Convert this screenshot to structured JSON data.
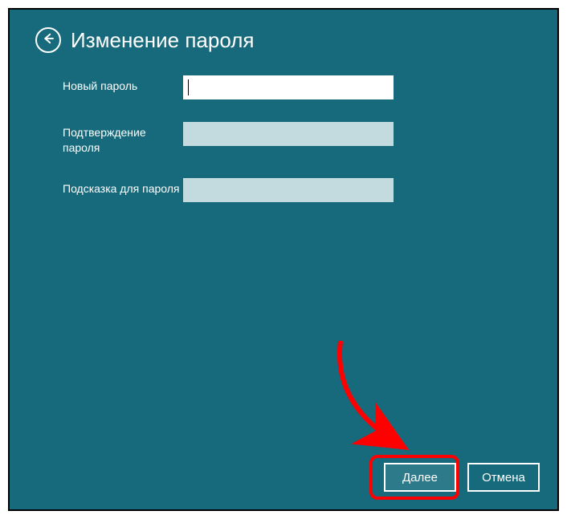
{
  "header": {
    "title": "Изменение пароля"
  },
  "form": {
    "new_password": {
      "label": "Новый пароль",
      "value": ""
    },
    "confirm_password": {
      "label": "Подтверждение пароля",
      "value": ""
    },
    "hint": {
      "label": "Подсказка для пароля",
      "value": ""
    }
  },
  "footer": {
    "next_label": "Далее",
    "cancel_label": "Отмена"
  }
}
